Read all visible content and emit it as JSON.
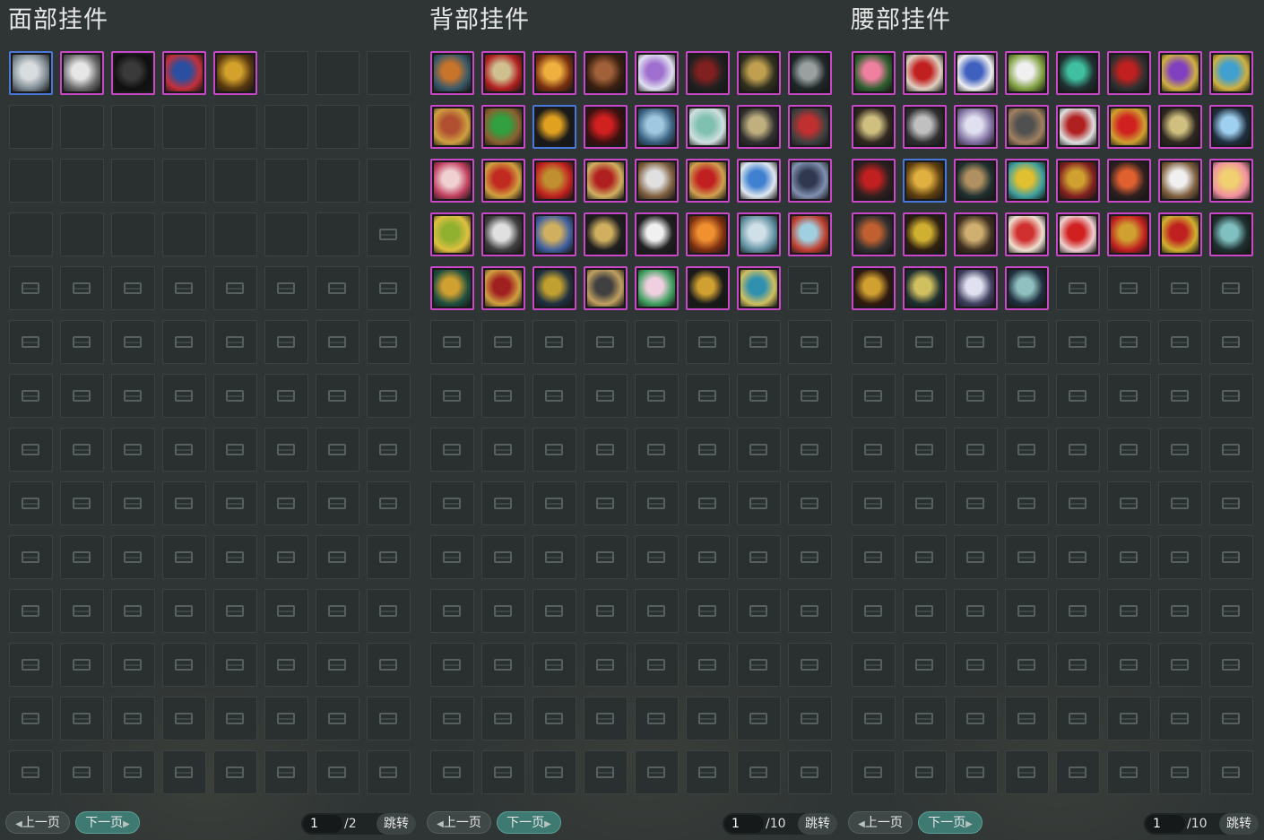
{
  "panels": [
    {
      "title": "面部挂件",
      "prev_label": "上一页",
      "next_label": "下一页",
      "page_current": "1",
      "page_total": "/2",
      "jump_label": "跳转",
      "slots": [
        {
          "state": "item",
          "frame": "blue",
          "icon": "white-bandana-mask-icon",
          "c1": "#d8dde0",
          "c2": "#7e8a92"
        },
        {
          "state": "item",
          "frame": "purple",
          "icon": "white-winged-mask-icon",
          "c1": "#e6e6e6",
          "c2": "#6b6b6b"
        },
        {
          "state": "item",
          "frame": "purple",
          "icon": "dark-veil-mask-icon",
          "c1": "#3a3a3a",
          "c2": "#101010"
        },
        {
          "state": "item",
          "frame": "purple",
          "icon": "blue-rose-veil-icon",
          "c1": "#2a4fa0",
          "c2": "#c2303a"
        },
        {
          "state": "item",
          "frame": "purple",
          "icon": "golden-mask-icon",
          "c1": "#d4a22c",
          "c2": "#5a3a10"
        },
        {
          "state": "empty"
        },
        {
          "state": "empty"
        },
        {
          "state": "empty"
        },
        {
          "state": "empty"
        },
        {
          "state": "empty"
        },
        {
          "state": "empty"
        },
        {
          "state": "empty"
        },
        {
          "state": "empty"
        },
        {
          "state": "empty"
        },
        {
          "state": "empty"
        },
        {
          "state": "empty"
        },
        {
          "state": "empty"
        },
        {
          "state": "empty"
        },
        {
          "state": "empty"
        },
        {
          "state": "empty"
        },
        {
          "state": "empty"
        },
        {
          "state": "empty"
        },
        {
          "state": "empty"
        },
        {
          "state": "empty"
        },
        {
          "state": "empty"
        },
        {
          "state": "empty"
        },
        {
          "state": "empty"
        },
        {
          "state": "empty"
        },
        {
          "state": "empty"
        },
        {
          "state": "empty"
        },
        {
          "state": "empty"
        },
        {
          "state": "locked"
        }
      ]
    },
    {
      "title": "背部挂件",
      "prev_label": "上一页",
      "next_label": "下一页",
      "page_current": "1",
      "page_total": "/10",
      "jump_label": "跳转",
      "slots": [
        {
          "state": "item",
          "frame": "purple",
          "icon": "gourd-icon",
          "c1": "#c8742a",
          "c2": "#3a5a6a"
        },
        {
          "state": "item",
          "frame": "purple",
          "icon": "red-mask-fan-icon",
          "c1": "#d0c090",
          "c2": "#b02020"
        },
        {
          "state": "item",
          "frame": "purple",
          "icon": "golden-ring-icon",
          "c1": "#f0b040",
          "c2": "#7a3010"
        },
        {
          "state": "item",
          "frame": "purple",
          "icon": "wooden-staff-icon",
          "c1": "#a0603a",
          "c2": "#3a2010"
        },
        {
          "state": "item",
          "frame": "purple",
          "icon": "purple-lantern-icon",
          "c1": "#a070d0",
          "c2": "#e0e0f0"
        },
        {
          "state": "item",
          "frame": "purple",
          "icon": "dark-dragon-icon",
          "c1": "#802020",
          "c2": "#202020"
        },
        {
          "state": "item",
          "frame": "purple",
          "icon": "golden-triangle-icon",
          "c1": "#c0a050",
          "c2": "#303020"
        },
        {
          "state": "item",
          "frame": "purple",
          "icon": "spear-icon",
          "c1": "#9aa0a0",
          "c2": "#202828"
        },
        {
          "state": "item",
          "frame": "purple",
          "icon": "bronze-bell-icon",
          "c1": "#b05030",
          "c2": "#d0a040"
        },
        {
          "state": "item",
          "frame": "purple",
          "icon": "green-frog-box-icon",
          "c1": "#30a040",
          "c2": "#8a6030"
        },
        {
          "state": "item",
          "frame": "blue",
          "icon": "golden-pipa-icon",
          "c1": "#e0a020",
          "c2": "#1a1a1a"
        },
        {
          "state": "item",
          "frame": "purple",
          "icon": "red-wings-icon",
          "c1": "#d02020",
          "c2": "#401010"
        },
        {
          "state": "item",
          "frame": "purple",
          "icon": "blue-cloud-icon",
          "c1": "#a0c8e0",
          "c2": "#3a6080"
        },
        {
          "state": "item",
          "frame": "purple",
          "icon": "jade-sword-icon",
          "c1": "#80c0b0",
          "c2": "#d0e0e0"
        },
        {
          "state": "item",
          "frame": "purple",
          "icon": "crossed-blades-icon",
          "c1": "#c0b080",
          "c2": "#303030"
        },
        {
          "state": "item",
          "frame": "purple",
          "icon": "red-crossbow-icon",
          "c1": "#c03030",
          "c2": "#404040"
        },
        {
          "state": "item",
          "frame": "purple",
          "icon": "white-rose-icon",
          "c1": "#f0d0d0",
          "c2": "#c04060"
        },
        {
          "state": "item",
          "frame": "purple",
          "icon": "red-scroll-icon",
          "c1": "#c02a20",
          "c2": "#d0a040"
        },
        {
          "state": "item",
          "frame": "purple",
          "icon": "golden-bow-icon",
          "c1": "#c09030",
          "c2": "#c02020"
        },
        {
          "state": "item",
          "frame": "purple",
          "icon": "lantern-bunch-icon",
          "c1": "#b02020",
          "c2": "#d0b060"
        },
        {
          "state": "item",
          "frame": "purple",
          "icon": "bottle-set-icon",
          "c1": "#e0e0e0",
          "c2": "#806040"
        },
        {
          "state": "item",
          "frame": "purple",
          "icon": "red-umbrella-icon",
          "c1": "#c02020",
          "c2": "#d0a050"
        },
        {
          "state": "item",
          "frame": "purple",
          "icon": "blue-spirit-icon",
          "c1": "#4080d0",
          "c2": "#e0e8f0"
        },
        {
          "state": "item",
          "frame": "purple",
          "icon": "dark-blades-icon",
          "c1": "#303850",
          "c2": "#8090b0"
        },
        {
          "state": "item",
          "frame": "purple",
          "icon": "jade-flower-icon",
          "c1": "#90b030",
          "c2": "#e0c040"
        },
        {
          "state": "item",
          "frame": "purple",
          "icon": "silver-axe-icon",
          "c1": "#e0e0e0",
          "c2": "#404040"
        },
        {
          "state": "item",
          "frame": "purple",
          "icon": "golden-compass-icon",
          "c1": "#d0b060",
          "c2": "#4060a0"
        },
        {
          "state": "item",
          "frame": "purple",
          "icon": "golden-bird-icon",
          "c1": "#d0b060",
          "c2": "#202020"
        },
        {
          "state": "item",
          "frame": "purple",
          "icon": "white-swords-icon",
          "c1": "#f0f0f0",
          "c2": "#202020"
        },
        {
          "state": "item",
          "frame": "purple",
          "icon": "orange-orb-icon",
          "c1": "#f09030",
          "c2": "#803010"
        },
        {
          "state": "item",
          "frame": "purple",
          "icon": "snowflake-orb-icon",
          "c1": "#d0e0e8",
          "c2": "#6090a0"
        },
        {
          "state": "item",
          "frame": "purple",
          "icon": "fish-bowl-icon",
          "c1": "#a0d0e0",
          "c2": "#c04030"
        },
        {
          "state": "item",
          "frame": "purple",
          "icon": "golden-wreath-icon",
          "c1": "#d0a030",
          "c2": "#205040"
        },
        {
          "state": "item",
          "frame": "purple",
          "icon": "red-treasure-chest-icon",
          "c1": "#a02020",
          "c2": "#d0a040"
        },
        {
          "state": "item",
          "frame": "purple",
          "icon": "golden-blade-icon",
          "c1": "#c0a030",
          "c2": "#203040"
        },
        {
          "state": "item",
          "frame": "purple",
          "icon": "black-spear-icon",
          "c1": "#404040",
          "c2": "#c0a060"
        },
        {
          "state": "item",
          "frame": "purple",
          "icon": "lotus-egg-icon",
          "c1": "#f0d0e0",
          "c2": "#40a060"
        },
        {
          "state": "item",
          "frame": "purple",
          "icon": "skull-crest-icon",
          "c1": "#d0a030",
          "c2": "#1a1a1a"
        },
        {
          "state": "item",
          "frame": "purple",
          "icon": "kingfisher-icon",
          "c1": "#3090b0",
          "c2": "#d0c060"
        },
        {
          "state": "empty_locked"
        },
        {
          "state": "locked"
        },
        {
          "state": "locked"
        },
        {
          "state": "locked"
        },
        {
          "state": "locked"
        },
        {
          "state": "locked"
        },
        {
          "state": "locked"
        },
        {
          "state": "locked"
        },
        {
          "state": "locked"
        }
      ]
    },
    {
      "title": "腰部挂件",
      "prev_label": "上一页",
      "next_label": "下一页",
      "page_current": "1",
      "page_total": "/10",
      "jump_label": "跳转",
      "slots": [
        {
          "state": "item",
          "frame": "purple",
          "icon": "pink-peony-icon",
          "c1": "#f080a0",
          "c2": "#306030"
        },
        {
          "state": "item",
          "frame": "purple",
          "icon": "charm-string-icon",
          "c1": "#c02020",
          "c2": "#e0d0c0"
        },
        {
          "state": "item",
          "frame": "purple",
          "icon": "blue-lotus-icon",
          "c1": "#4060c0",
          "c2": "#f0f0f0"
        },
        {
          "state": "item",
          "frame": "purple",
          "icon": "white-bird-icon",
          "c1": "#f0f0f0",
          "c2": "#80a040"
        },
        {
          "state": "item",
          "frame": "purple",
          "icon": "jade-ring-icon",
          "c1": "#40c0a0",
          "c2": "#203030"
        },
        {
          "state": "item",
          "frame": "purple",
          "icon": "red-demon-icon",
          "c1": "#c02020",
          "c2": "#303030"
        },
        {
          "state": "item",
          "frame": "purple",
          "icon": "purple-tassel-icon",
          "c1": "#8040c0",
          "c2": "#d0b040"
        },
        {
          "state": "item",
          "frame": "purple",
          "icon": "blue-golden-charm-icon",
          "c1": "#40a0d0",
          "c2": "#d0b040"
        },
        {
          "state": "item",
          "frame": "purple",
          "icon": "golden-vine-icon",
          "c1": "#d0c080",
          "c2": "#302820"
        },
        {
          "state": "item",
          "frame": "purple",
          "icon": "silver-dagger-icon",
          "c1": "#c0c0c0",
          "c2": "#303030"
        },
        {
          "state": "item",
          "frame": "purple",
          "icon": "white-dragon-icon",
          "c1": "#e0e0f0",
          "c2": "#8070a0"
        },
        {
          "state": "item",
          "frame": "purple",
          "icon": "dark-katana-icon",
          "c1": "#505050",
          "c2": "#a08060"
        },
        {
          "state": "item",
          "frame": "purple",
          "icon": "red-pouch-icon",
          "c1": "#b02020",
          "c2": "#e0e0e0"
        },
        {
          "state": "item",
          "frame": "purple",
          "icon": "ruby-amulet-icon",
          "c1": "#d02020",
          "c2": "#d0a030"
        },
        {
          "state": "item",
          "frame": "purple",
          "icon": "golden-claws-icon",
          "c1": "#d0c080",
          "c2": "#302820"
        },
        {
          "state": "item",
          "frame": "purple",
          "icon": "blue-fairy-icon",
          "c1": "#a0d0f0",
          "c2": "#203040"
        },
        {
          "state": "item",
          "frame": "purple",
          "icon": "red-knot-icon",
          "c1": "#c02020",
          "c2": "#302020"
        },
        {
          "state": "item",
          "frame": "blue",
          "icon": "golden-bell-icon",
          "c1": "#e0b040",
          "c2": "#604010"
        },
        {
          "state": "item",
          "frame": "purple",
          "icon": "dark-horn-icon",
          "c1": "#b09060",
          "c2": "#203030"
        },
        {
          "state": "item",
          "frame": "purple",
          "icon": "golden-horn-icon",
          "c1": "#e0c030",
          "c2": "#40a0a0"
        },
        {
          "state": "item",
          "frame": "purple",
          "icon": "golden-gourd-icon",
          "c1": "#d0a030",
          "c2": "#802020"
        },
        {
          "state": "item",
          "frame": "purple",
          "icon": "orange-crab-icon",
          "c1": "#e06030",
          "c2": "#302020"
        },
        {
          "state": "item",
          "frame": "purple",
          "icon": "white-beads-icon",
          "c1": "#f0f0f0",
          "c2": "#806040"
        },
        {
          "state": "item",
          "frame": "purple",
          "icon": "yellow-pig-icon",
          "c1": "#f0d070",
          "c2": "#f090a0"
        },
        {
          "state": "item",
          "frame": "purple",
          "icon": "warrior-figure-icon",
          "c1": "#c06030",
          "c2": "#303030"
        },
        {
          "state": "item",
          "frame": "purple",
          "icon": "golden-turtle-icon",
          "c1": "#d0b030",
          "c2": "#302010"
        },
        {
          "state": "item",
          "frame": "purple",
          "icon": "spiral-shell-icon",
          "c1": "#d0b070",
          "c2": "#403020"
        },
        {
          "state": "item",
          "frame": "purple",
          "icon": "red-dial-icon",
          "c1": "#d03030",
          "c2": "#f0e0d0"
        },
        {
          "state": "item",
          "frame": "purple",
          "icon": "plum-blossom-icon",
          "c1": "#d02020",
          "c2": "#f0d0d0"
        },
        {
          "state": "item",
          "frame": "purple",
          "icon": "golden-fan-icon",
          "c1": "#d0a030",
          "c2": "#c02020"
        },
        {
          "state": "item",
          "frame": "purple",
          "icon": "red-apple-charm-icon",
          "c1": "#c02020",
          "c2": "#d0b030"
        },
        {
          "state": "item",
          "frame": "purple",
          "icon": "jade-sword-charm-icon",
          "c1": "#80c0c0",
          "c2": "#203030"
        },
        {
          "state": "item",
          "frame": "purple",
          "icon": "golden-tassel-icon",
          "c1": "#d0a030",
          "c2": "#301a10"
        },
        {
          "state": "item",
          "frame": "purple",
          "icon": "golden-feather-icon",
          "c1": "#d0c060",
          "c2": "#203030"
        },
        {
          "state": "item",
          "frame": "purple",
          "icon": "silver-trophy-icon",
          "c1": "#e0e0f0",
          "c2": "#404060"
        },
        {
          "state": "item",
          "frame": "purple",
          "icon": "jade-vase-icon",
          "c1": "#90c0c0",
          "c2": "#203040"
        },
        {
          "state": "empty_locked"
        },
        {
          "state": "empty_locked"
        },
        {
          "state": "empty_locked"
        },
        {
          "state": "empty_locked"
        },
        {
          "state": "locked"
        },
        {
          "state": "locked"
        },
        {
          "state": "locked"
        },
        {
          "state": "locked"
        },
        {
          "state": "locked"
        },
        {
          "state": "locked"
        },
        {
          "state": "locked"
        },
        {
          "state": "locked"
        }
      ]
    }
  ]
}
